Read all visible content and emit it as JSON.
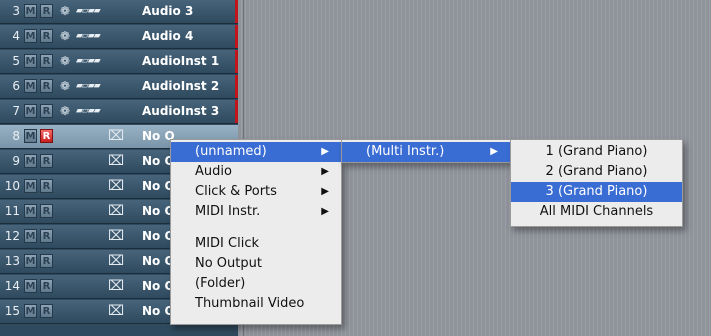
{
  "tracks": [
    {
      "num": "3",
      "m": "M",
      "r": "R",
      "name": "Audio 3",
      "type": "audio",
      "armed": false,
      "selected": false
    },
    {
      "num": "4",
      "m": "M",
      "r": "R",
      "name": "Audio 4",
      "type": "audio",
      "armed": false,
      "selected": false
    },
    {
      "num": "5",
      "m": "M",
      "r": "R",
      "name": "AudioInst  1",
      "type": "audio",
      "armed": false,
      "selected": false
    },
    {
      "num": "6",
      "m": "M",
      "r": "R",
      "name": "AudioInst  2",
      "type": "audio",
      "armed": false,
      "selected": false
    },
    {
      "num": "7",
      "m": "M",
      "r": "R",
      "name": "AudioInst  3",
      "type": "audio",
      "armed": false,
      "selected": false
    },
    {
      "num": "8",
      "m": "M",
      "r": "R",
      "name": "No O",
      "type": "midi",
      "armed": true,
      "selected": true
    },
    {
      "num": "9",
      "m": "M",
      "r": "R",
      "name": "No O",
      "type": "midi",
      "armed": false,
      "selected": false
    },
    {
      "num": "10",
      "m": "M",
      "r": "R",
      "name": "No O",
      "type": "midi",
      "armed": false,
      "selected": false
    },
    {
      "num": "11",
      "m": "M",
      "r": "R",
      "name": "No O",
      "type": "midi",
      "armed": false,
      "selected": false
    },
    {
      "num": "12",
      "m": "M",
      "r": "R",
      "name": "No O",
      "type": "midi",
      "armed": false,
      "selected": false
    },
    {
      "num": "13",
      "m": "M",
      "r": "R",
      "name": "No O",
      "type": "midi",
      "armed": false,
      "selected": false
    },
    {
      "num": "14",
      "m": "M",
      "r": "R",
      "name": "No O",
      "type": "midi",
      "armed": false,
      "selected": false
    },
    {
      "num": "15",
      "m": "M",
      "r": "R",
      "name": "No Output",
      "type": "midi",
      "armed": false,
      "selected": false
    }
  ],
  "icons": {
    "symbol": "❁",
    "waveform": "▰▱▰▰",
    "midi_off": "⌧"
  },
  "colors": {
    "highlight": "#3a6dd4",
    "record_armed": "#c71f1f",
    "track_bg": "#2f4a5e",
    "selected_track_bg": "#7a95a9"
  },
  "menus": {
    "main": {
      "items": [
        {
          "label": "(unnamed)",
          "submenu": true,
          "highlight": true
        },
        {
          "label": "Audio",
          "submenu": true,
          "highlight": false
        },
        {
          "label": "Click & Ports",
          "submenu": true,
          "highlight": false
        },
        {
          "label": "MIDI Instr.",
          "submenu": true,
          "highlight": false
        },
        {
          "separator": true
        },
        {
          "label": "MIDI Click",
          "submenu": false,
          "highlight": false
        },
        {
          "label": "No Output",
          "submenu": false,
          "highlight": false
        },
        {
          "label": "(Folder)",
          "submenu": false,
          "highlight": false
        },
        {
          "label": "Thumbnail Video",
          "submenu": false,
          "highlight": false
        }
      ]
    },
    "sub1": {
      "items": [
        {
          "label": "(Multi Instr.)",
          "submenu": true,
          "highlight": true
        }
      ]
    },
    "sub2": {
      "items": [
        {
          "label": "1  (Grand Piano)",
          "highlight": false
        },
        {
          "label": "2  (Grand Piano)",
          "highlight": false
        },
        {
          "label": "3  (Grand Piano)",
          "highlight": true
        },
        {
          "label": "All MIDI Channels",
          "highlight": false
        }
      ]
    },
    "arrow": "▶"
  }
}
